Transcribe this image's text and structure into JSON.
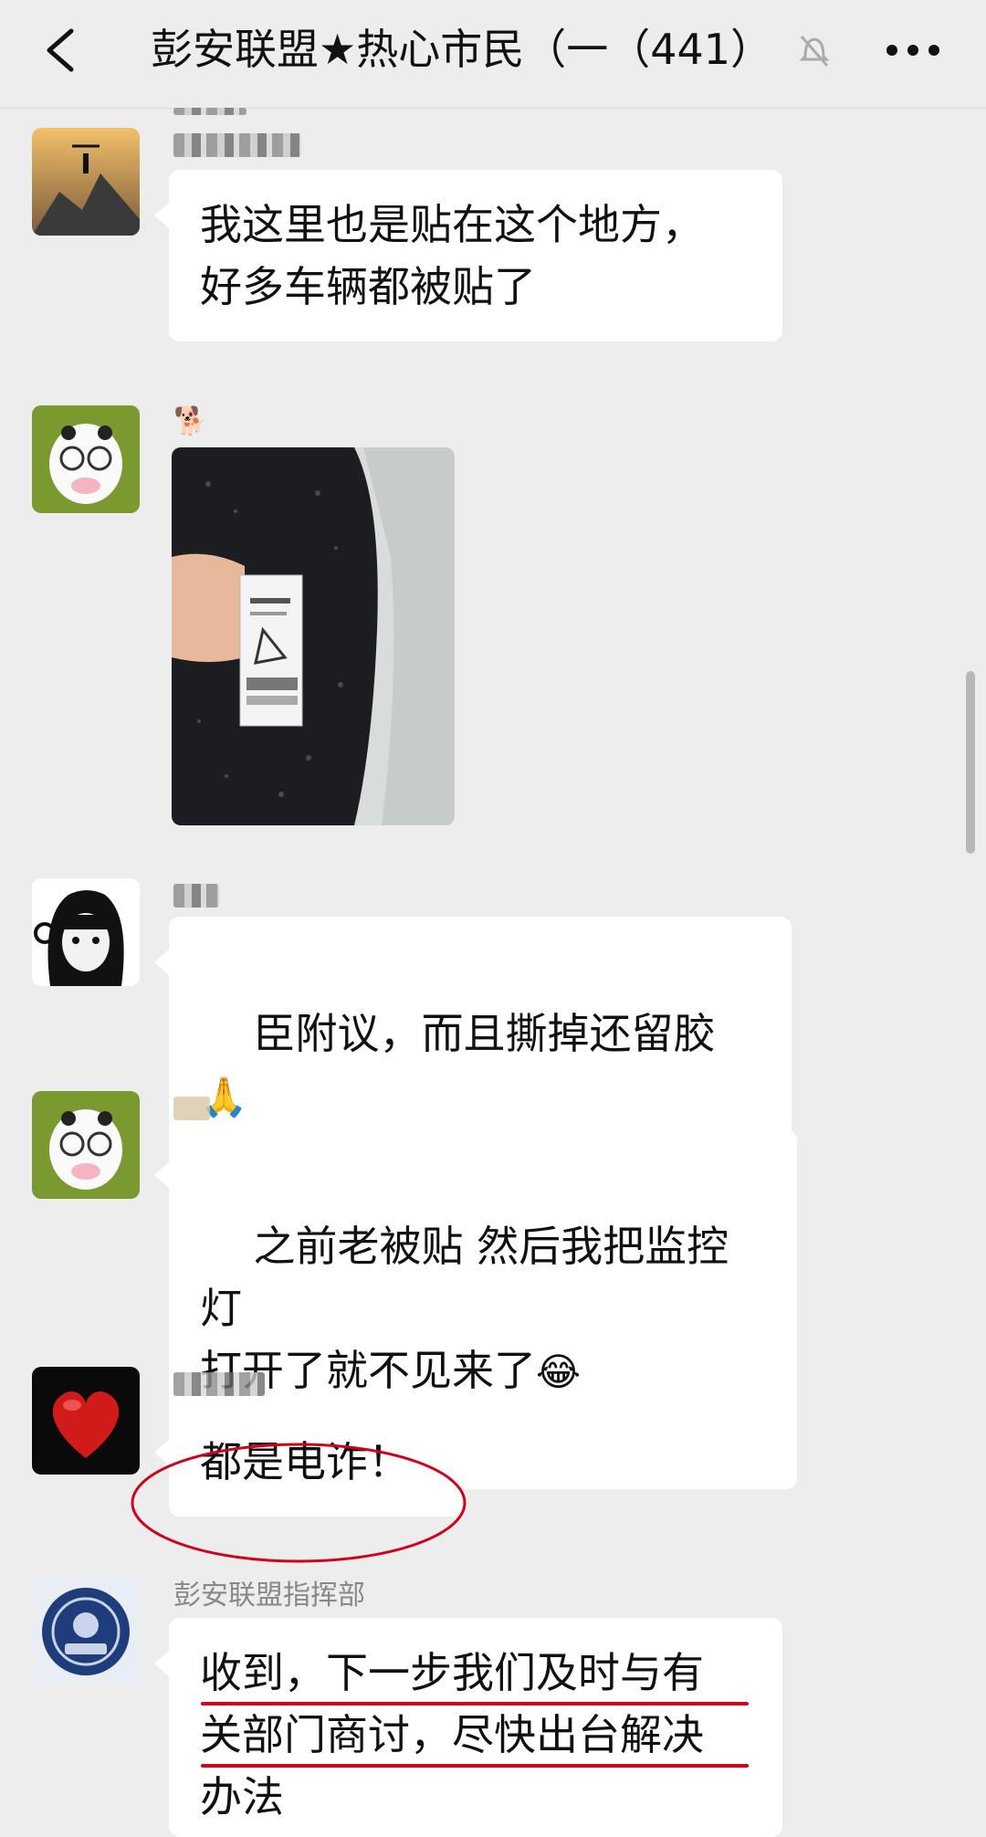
{
  "header": {
    "title": "彭安联盟★热心市民（一（441）",
    "back_icon": "chevron-left-icon",
    "mute_icon": "bell-off-icon",
    "more_icon": "more-horizontal-icon"
  },
  "messages": [
    {
      "text": "我这里也是贴在这个地方，\n好多车辆都被贴了"
    },
    {
      "image": "car-mirror-photo"
    },
    {
      "text": "臣附议，而且撕掉还留胶",
      "emoji": "🙏"
    },
    {
      "text": "之前老被贴 然后我把监控灯\n打开了就不见来了",
      "emoji": "😂"
    },
    {
      "text": "都是电诈！"
    },
    {
      "sender": "彭安联盟指挥部",
      "text": "收到，下一步我们及时与有\n关部门商讨，尽快出台解决\n办法"
    }
  ],
  "colors": {
    "background": "#ededed",
    "bubble": "#ffffff",
    "annotation_red": "#d0021b"
  }
}
